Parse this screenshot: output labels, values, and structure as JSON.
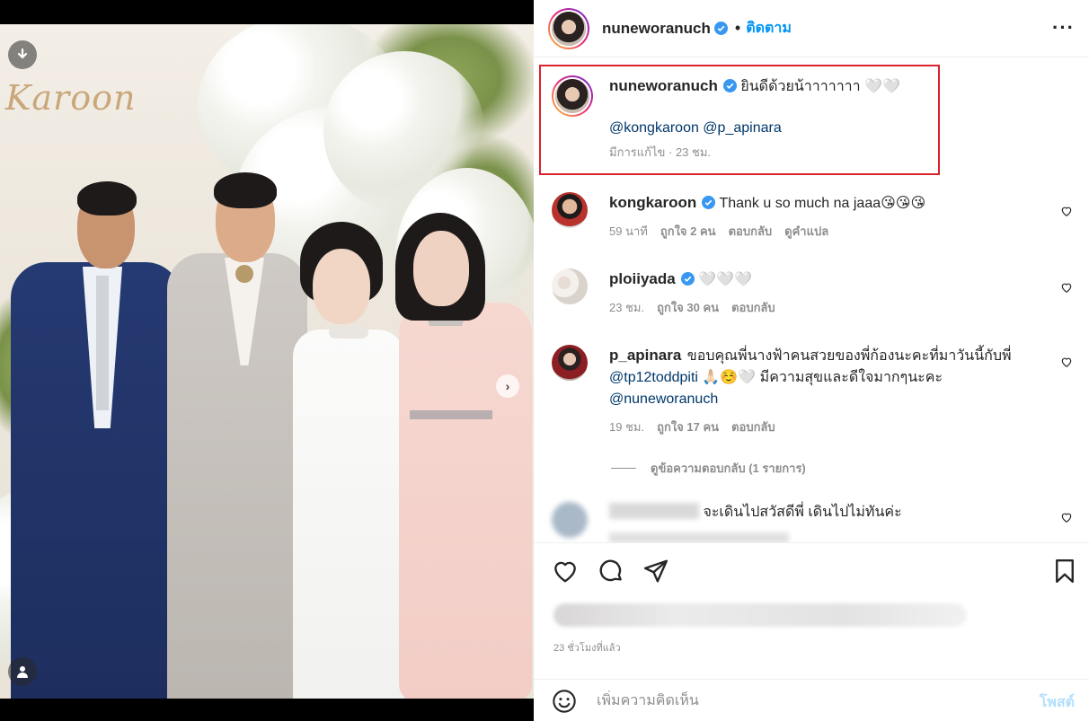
{
  "post": {
    "author": "nuneworanuch",
    "follow_label": "ติดตาม",
    "dot": "•",
    "more_label": "···",
    "watermark_text": "Karoon"
  },
  "caption": {
    "username": "nuneworanuch",
    "text": "ยินดีด้วยน้าาาาาาา 🤍🤍",
    "mentions": "@kongkaroon @p_apinara",
    "meta": "มีการแก้ไข · 23 ชม."
  },
  "comments": [
    {
      "username": "kongkaroon",
      "text": "Thank u so much na jaaa😘😘😘",
      "time": "59 นาที",
      "likes": "ถูกใจ 2 คน",
      "reply": "ตอบกลับ",
      "translate": "ดูคำแปล"
    },
    {
      "username": "ploiiyada",
      "text": "🤍🤍🤍",
      "time": "23 ชม.",
      "likes": "ถูกใจ 30 คน",
      "reply": "ตอบกลับ"
    },
    {
      "username": "p_apinara",
      "text1": "ขอบคุณพี่นางฟ้าคนสวยของพี่ก้องนะคะที่มาวันนี้กับพี่",
      "mention1": "@tp12toddpiti",
      "text2": " 🙏🏻☺️🤍 มีความสุขและดีใจมากๆนะคะ",
      "mention2": "@nuneworanuch",
      "time": "19 ชม.",
      "likes": "ถูกใจ 17 คน",
      "reply": "ตอบกลับ"
    },
    {
      "text": "จะเดินไปสวัสดีพี่ เดินไปไม่ทันค่ะ"
    }
  ],
  "view_replies": "ดูข้อความตอบกลับ (1 รายการ)",
  "post_time": "23 ชั่วโมงที่แล้ว",
  "comment_bar": {
    "placeholder": "เพิ่มความคิดเห็น",
    "post_label": "โพสต์"
  },
  "colors": {
    "highlight_border": "#d9232d",
    "link": "#00376b",
    "follow": "#0095f6",
    "verified": "#3897f0"
  },
  "icons": [
    "download-icon",
    "user-tag-icon",
    "chevron-right-icon",
    "verified-icon",
    "heart-icon",
    "comment-icon",
    "share-icon",
    "bookmark-icon",
    "emoji-icon",
    "more-icon"
  ],
  "carousel": {
    "total": 4,
    "active": 1
  }
}
